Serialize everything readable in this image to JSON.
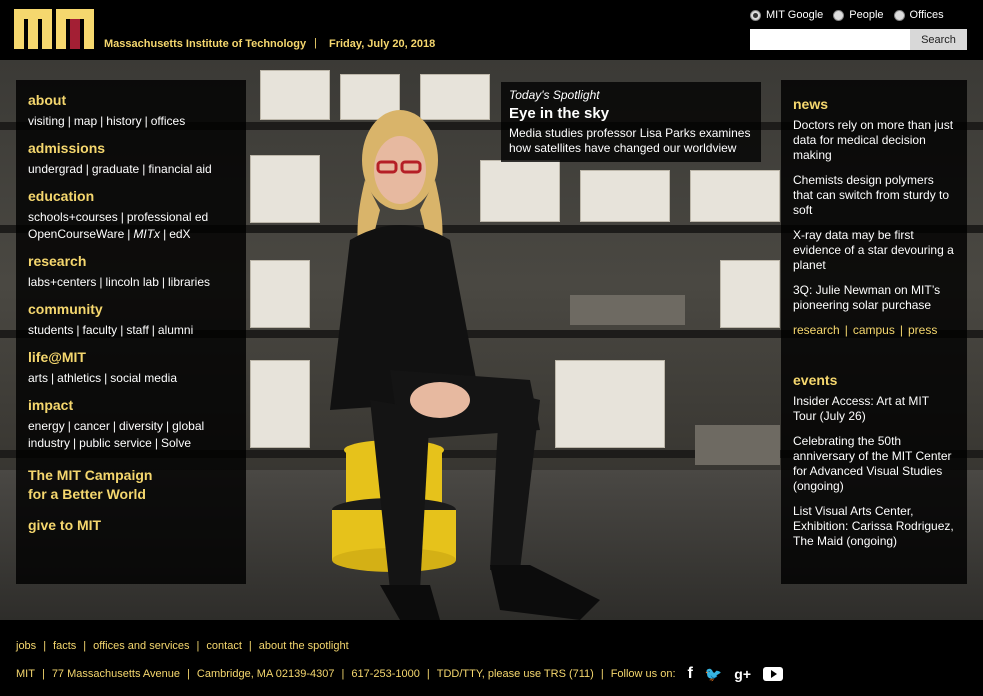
{
  "header": {
    "site_title": "Massachusetts Institute of Technology",
    "separator": "|",
    "date": "Friday, July 20, 2018",
    "search": {
      "options": [
        "MIT Google",
        "People",
        "Offices"
      ],
      "selected": "MIT Google",
      "input_value": "",
      "button_label": "Search"
    }
  },
  "colors": {
    "accent": "#f5d76e",
    "logo_red": "#a31f34",
    "logo_gray": "#8a8b8c",
    "panel_bg": "#000000"
  },
  "leftnav": {
    "about": {
      "head": "about",
      "links": [
        "visiting",
        "map",
        "history",
        "offices"
      ]
    },
    "admissions": {
      "head": "admissions",
      "links": [
        "undergrad",
        "graduate",
        "financial aid"
      ]
    },
    "education": {
      "head": "education",
      "line1": [
        "schools+courses",
        "professional ed"
      ],
      "line2": [
        "OpenCourseWare",
        "MITx",
        "edX"
      ]
    },
    "research": {
      "head": "research",
      "links": [
        "labs+centers",
        "lincoln lab",
        "libraries"
      ]
    },
    "community": {
      "head": "community",
      "links": [
        "students",
        "faculty",
        "staff",
        "alumni"
      ]
    },
    "life": {
      "head": "life@MIT",
      "links": [
        "arts",
        "athletics",
        "social media"
      ]
    },
    "impact": {
      "head": "impact",
      "line1": [
        "energy",
        "cancer",
        "diversity",
        "global"
      ],
      "line2": [
        "industry",
        "public service",
        "Solve"
      ]
    },
    "campaign_line1": "The MIT Campaign",
    "campaign_line2": "for a Better World",
    "give": "give to MIT"
  },
  "spotlight": {
    "kicker": "Today's Spotlight",
    "title": "Eye in the sky",
    "description": "Media studies professor Lisa Parks examines how satellites have changed our worldview"
  },
  "news": {
    "head": "news",
    "items": [
      "Doctors rely on more than just data for medical decision making",
      "Chemists design polymers that can switch from sturdy to soft",
      "X-ray data may be first evidence of a star devouring a planet",
      "3Q: Julie Newman on MIT’s pioneering solar purchase"
    ],
    "tags": [
      "research",
      "campus",
      "press"
    ]
  },
  "events": {
    "head": "events",
    "items": [
      "Insider Access: Art at MIT Tour (July 26)",
      "Celebrating the 50th anniversary of the MIT Center for Advanced Visual Studies (ongoing)",
      "List Visual Arts Center, Exhibition: Carissa Rodriguez, The Maid (ongoing)"
    ]
  },
  "footer": {
    "row1": [
      "jobs",
      "facts",
      "offices and services",
      "contact",
      "about the spotlight"
    ],
    "row2": [
      "MIT",
      "77 Massachusetts Avenue",
      "Cambridge, MA 02139-4307",
      "617-253-1000",
      "TDD/TTY, please use TRS (711)"
    ],
    "follow": "Follow us on:",
    "social_icons": [
      "facebook-icon",
      "twitter-icon",
      "google-plus-icon",
      "youtube-icon"
    ],
    "facebook_glyph": "f",
    "twitter_glyph": "🐦",
    "gplus_glyph": "g+"
  }
}
